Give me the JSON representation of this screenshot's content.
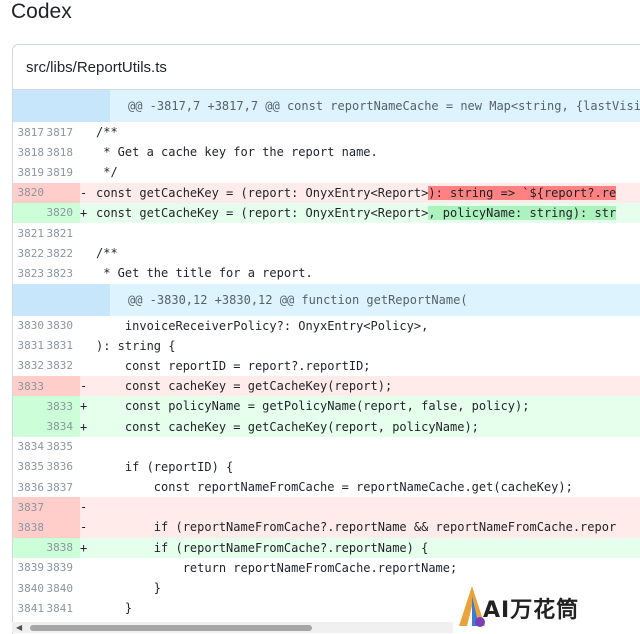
{
  "app": {
    "title": "Codex"
  },
  "file": {
    "path": "src/libs/ReportUtils.ts"
  },
  "rows": [
    {
      "type": "hunk",
      "code": "@@ -3817,7 +3817,7 @@ const reportNameCache = new Map<string, {lastVisib"
    },
    {
      "type": "ctx",
      "old": "3817",
      "new": "3817",
      "sign": "",
      "code": "/**"
    },
    {
      "type": "ctx",
      "old": "3818",
      "new": "3818",
      "sign": "",
      "code": " * Get a cache key for the report name."
    },
    {
      "type": "ctx",
      "old": "3819",
      "new": "3819",
      "sign": "",
      "code": " */"
    },
    {
      "type": "del",
      "old": "3820",
      "new": "",
      "sign": "-",
      "code": "const getCacheKey = (report: OnyxEntry<Report>",
      "hl": "): string => `${report?.re"
    },
    {
      "type": "add",
      "old": "",
      "new": "3820",
      "sign": "+",
      "code": "const getCacheKey = (report: OnyxEntry<Report>",
      "hl": ", policyName: string): str"
    },
    {
      "type": "ctx",
      "old": "3821",
      "new": "3821",
      "sign": "",
      "code": ""
    },
    {
      "type": "ctx",
      "old": "3822",
      "new": "3822",
      "sign": "",
      "code": "/**"
    },
    {
      "type": "ctx",
      "old": "3823",
      "new": "3823",
      "sign": "",
      "code": " * Get the title for a report."
    },
    {
      "type": "hunk",
      "code": "@@ -3830,12 +3830,12 @@ function getReportName("
    },
    {
      "type": "ctx",
      "old": "3830",
      "new": "3830",
      "sign": "",
      "code": "    invoiceReceiverPolicy?: OnyxEntry<Policy>,"
    },
    {
      "type": "ctx",
      "old": "3831",
      "new": "3831",
      "sign": "",
      "code": "): string {"
    },
    {
      "type": "ctx",
      "old": "3832",
      "new": "3832",
      "sign": "",
      "code": "    const reportID = report?.reportID;"
    },
    {
      "type": "del",
      "old": "3833",
      "new": "",
      "sign": "-",
      "code": "    const cacheKey = getCacheKey(report);"
    },
    {
      "type": "add",
      "old": "",
      "new": "3833",
      "sign": "+",
      "code": "    const policyName = getPolicyName(report, false, policy);"
    },
    {
      "type": "add",
      "old": "",
      "new": "3834",
      "sign": "+",
      "code": "    const cacheKey = getCacheKey(report, policyName);"
    },
    {
      "type": "ctx",
      "old": "3834",
      "new": "3835",
      "sign": "",
      "code": ""
    },
    {
      "type": "ctx",
      "old": "3835",
      "new": "3836",
      "sign": "",
      "code": "    if (reportID) {"
    },
    {
      "type": "ctx",
      "old": "3836",
      "new": "3837",
      "sign": "",
      "code": "        const reportNameFromCache = reportNameCache.get(cacheKey);"
    },
    {
      "type": "del",
      "old": "3837",
      "new": "",
      "sign": "-",
      "code": ""
    },
    {
      "type": "del",
      "old": "3838",
      "new": "",
      "sign": "-",
      "code": "        if (reportNameFromCache?.reportName && reportNameFromCache.repor"
    },
    {
      "type": "add",
      "old": "",
      "new": "3838",
      "sign": "+",
      "code": "        if (reportNameFromCache?.reportName) {"
    },
    {
      "type": "ctx",
      "old": "3839",
      "new": "3839",
      "sign": "",
      "code": "            return reportNameFromCache.reportName;"
    },
    {
      "type": "ctx",
      "old": "3840",
      "new": "3840",
      "sign": "",
      "code": "        }"
    },
    {
      "type": "ctx",
      "old": "3841",
      "new": "3841",
      "sign": "",
      "code": "    }"
    }
  ],
  "watermark": {
    "text": "AI万花筒"
  },
  "colors": {
    "hunk_bg": "#ddf4ff",
    "del_bg": "#ffebe9",
    "add_bg": "#e6ffec",
    "del_hl": "#ff8182",
    "add_hl": "#abf2bc"
  }
}
